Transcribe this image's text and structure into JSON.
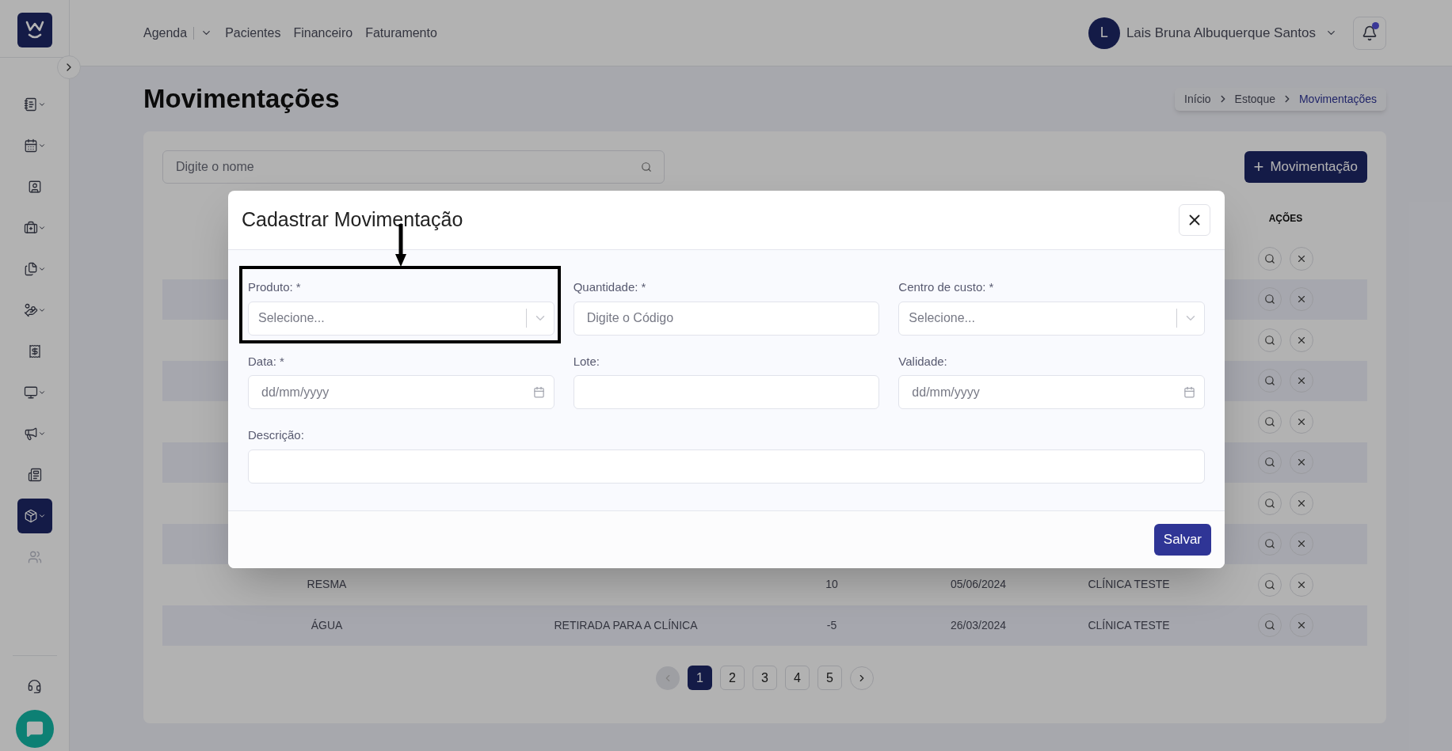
{
  "sidebar": {
    "items": [
      {
        "expandable": true,
        "selected": false,
        "disabled": false
      },
      {
        "expandable": true,
        "selected": false,
        "disabled": false
      },
      {
        "expandable": false,
        "selected": false,
        "disabled": false
      },
      {
        "expandable": true,
        "selected": false,
        "disabled": false
      },
      {
        "expandable": true,
        "selected": false,
        "disabled": false
      },
      {
        "expandable": true,
        "selected": false,
        "disabled": false
      },
      {
        "expandable": false,
        "selected": false,
        "disabled": false
      },
      {
        "expandable": true,
        "selected": false,
        "disabled": false
      },
      {
        "expandable": true,
        "selected": false,
        "disabled": false
      },
      {
        "expandable": false,
        "selected": false,
        "disabled": false
      },
      {
        "expandable": true,
        "selected": true,
        "disabled": false
      },
      {
        "expandable": false,
        "selected": false,
        "disabled": true
      }
    ]
  },
  "top_nav": {
    "items": [
      {
        "label": "Agenda",
        "dropdown": true
      },
      {
        "label": "Pacientes",
        "dropdown": false
      },
      {
        "label": "Financeiro",
        "dropdown": false
      },
      {
        "label": "Faturamento",
        "dropdown": false
      }
    ],
    "user": {
      "initial": "L",
      "name": "Lais Bruna Albuquerque Santos"
    },
    "notifications": {
      "unread": true
    }
  },
  "page": {
    "title": "Movimentações",
    "breadcrumb": [
      {
        "label": "Início",
        "current": false
      },
      {
        "label": "Estoque",
        "current": false
      },
      {
        "label": "Movimentações",
        "current": true
      }
    ],
    "search": {
      "placeholder": "Digite o nome"
    },
    "add_button": {
      "icon": "+",
      "label": "Movimentação"
    }
  },
  "table": {
    "actions_heading": "AÇÕES",
    "rows": [
      {
        "striped": false
      },
      {
        "striped": true
      },
      {
        "striped": false
      },
      {
        "striped": true
      },
      {
        "striped": false
      },
      {
        "striped": true
      },
      {
        "striped": false
      },
      {
        "striped": true
      },
      {
        "striped": false,
        "product": "RESMA",
        "quantity": "10",
        "date": "05/06/2024",
        "cost_center": "CLÍNICA TESTE"
      },
      {
        "striped": true,
        "product": "ÁGUA",
        "description": "RETIRADA PARA A CLÍNICA",
        "quantity": "-5",
        "date": "26/03/2024",
        "cost_center": "CLÍNICA TESTE"
      }
    ]
  },
  "pagination": {
    "pages": [
      {
        "label": "1",
        "selected": true
      },
      {
        "label": "2",
        "selected": false
      },
      {
        "label": "3",
        "selected": false
      },
      {
        "label": "4",
        "selected": false
      },
      {
        "label": "5",
        "selected": false
      }
    ],
    "prev_disabled": true
  },
  "modal": {
    "title": "Cadastrar Movimentação",
    "fields": [
      {
        "kind": "select",
        "label": "Produto: *",
        "placeholder": "Selecione...",
        "highlighted": true,
        "full_width": false
      },
      {
        "kind": "text",
        "label": "Quantidade: *",
        "placeholder": "Digite o Código",
        "highlighted": false,
        "full_width": false
      },
      {
        "kind": "select",
        "label": "Centro de custo: *",
        "placeholder": "Selecione...",
        "highlighted": false,
        "full_width": false
      },
      {
        "kind": "date",
        "label": "Data: *",
        "placeholder": "dd/mm/yyyy",
        "highlighted": false,
        "full_width": false
      },
      {
        "kind": "text",
        "label": "Lote:",
        "highlighted": false,
        "full_width": false
      },
      {
        "kind": "date",
        "label": "Validade:",
        "placeholder": "dd/mm/yyyy",
        "highlighted": false,
        "full_width": false
      },
      {
        "kind": "text",
        "label": "Descrição:",
        "highlighted": false,
        "full_width": true
      }
    ],
    "save_button": "Salvar"
  }
}
